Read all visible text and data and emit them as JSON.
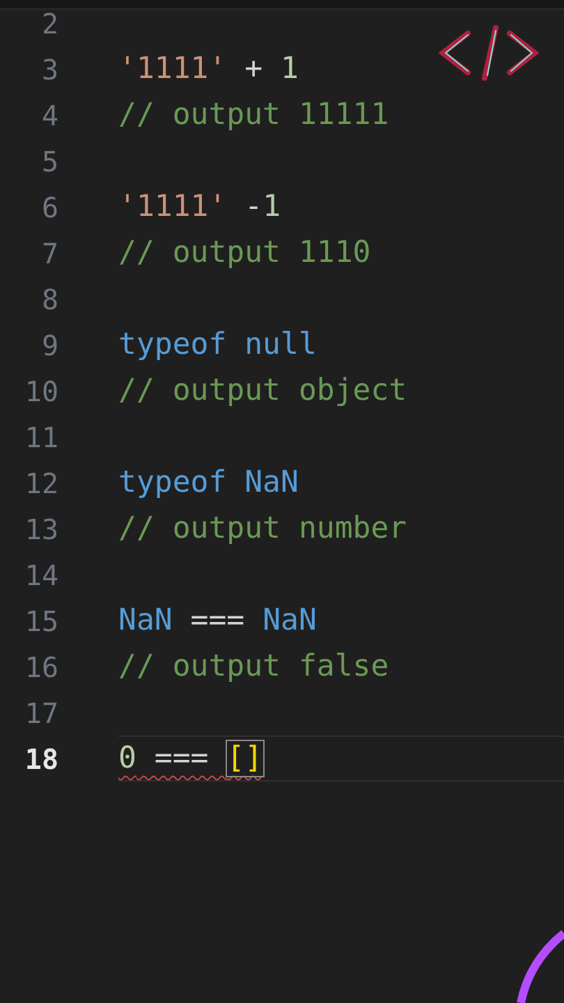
{
  "editor": {
    "lines": [
      {
        "number": "2",
        "active": false
      },
      {
        "number": "3",
        "active": false,
        "tokens": [
          {
            "kind": "string",
            "text": "'1111'"
          },
          {
            "kind": "plain",
            "text": " + "
          },
          {
            "kind": "number",
            "text": "1"
          }
        ]
      },
      {
        "number": "4",
        "active": false,
        "tokens": [
          {
            "kind": "comment",
            "text": "// output 11111"
          }
        ]
      },
      {
        "number": "5",
        "active": false
      },
      {
        "number": "6",
        "active": false,
        "tokens": [
          {
            "kind": "string",
            "text": "'1111'"
          },
          {
            "kind": "plain",
            "text": " -"
          },
          {
            "kind": "number",
            "text": "1"
          }
        ]
      },
      {
        "number": "7",
        "active": false,
        "tokens": [
          {
            "kind": "comment",
            "text": "// output 1110"
          }
        ]
      },
      {
        "number": "8",
        "active": false
      },
      {
        "number": "9",
        "active": false,
        "tokens": [
          {
            "kind": "keyword",
            "text": "typeof null"
          }
        ]
      },
      {
        "number": "10",
        "active": false,
        "tokens": [
          {
            "kind": "comment",
            "text": "// output object"
          }
        ]
      },
      {
        "number": "11",
        "active": false
      },
      {
        "number": "12",
        "active": false,
        "tokens": [
          {
            "kind": "keyword",
            "text": "typeof NaN"
          }
        ]
      },
      {
        "number": "13",
        "active": false,
        "tokens": [
          {
            "kind": "comment",
            "text": "// output number"
          }
        ]
      },
      {
        "number": "14",
        "active": false
      },
      {
        "number": "15",
        "active": false,
        "tokens": [
          {
            "kind": "keyword",
            "text": "NaN"
          },
          {
            "kind": "plain",
            "text": " === "
          },
          {
            "kind": "keyword",
            "text": "NaN"
          }
        ]
      },
      {
        "number": "16",
        "active": false,
        "tokens": [
          {
            "kind": "comment",
            "text": "// output false"
          }
        ]
      },
      {
        "number": "17",
        "active": false
      },
      {
        "number": "18",
        "active": true,
        "tokens": [
          {
            "kind": "number",
            "text": "0",
            "error": true
          },
          {
            "kind": "plain",
            "text": " === ",
            "error": true
          },
          {
            "kind": "bracket",
            "text": "[]",
            "error": true,
            "matched": true
          }
        ]
      }
    ]
  }
}
